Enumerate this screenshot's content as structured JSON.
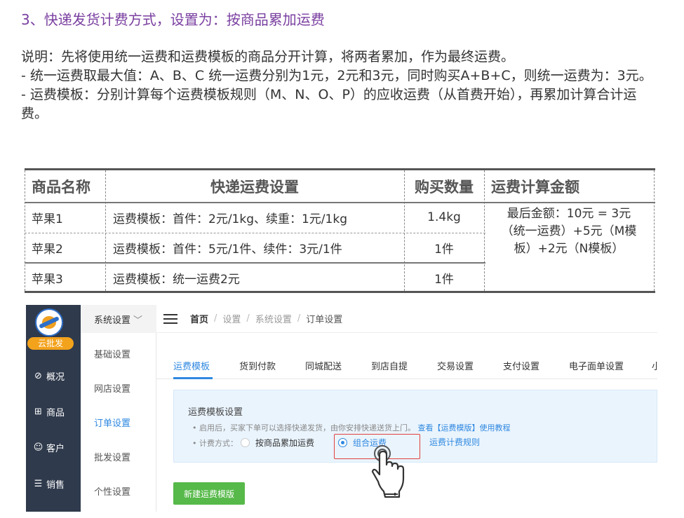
{
  "heading": "3、快递发货计费方式，设置为：按商品累加运费",
  "description": {
    "line1": "说明：先将使用统一运费和运费模板的商品分开计算，将两者累加，作为最终运费。",
    "line2": "- 统一运费取最大值：A、B、C 统一运费分别为1元，2元和3元，同时购买A+B+C，则统一运费为：3元。",
    "line3": "- 运费模板：分别计算每个运费模板规则（M、N、O、P）的应收运费（从首费开始），再累加计算合计运费。"
  },
  "table": {
    "headers": [
      "商品名称",
      "快递运费设置",
      "购买数量",
      "运费计算金额"
    ],
    "rows": [
      {
        "name": "苹果1",
        "setting": "运费模板：首件：2元/1kg、续重：1元/1kg",
        "qty": "1.4kg"
      },
      {
        "name": "苹果2",
        "setting": "运费模板：首件：5元/1件、续件：3元/1件",
        "qty": "1件"
      },
      {
        "name": "苹果3",
        "setting": "运费模板：统一运费2元",
        "qty": "1件"
      }
    ],
    "total_line1": "最后金额：10元 = 3元",
    "total_line2": "（统一运费）+5元（M模",
    "total_line3": "板）+2元（N模板）"
  },
  "app": {
    "brand": "云批发",
    "main_nav": [
      {
        "label": "概况",
        "icon": "compass-icon"
      },
      {
        "label": "商品",
        "icon": "grid-icon"
      },
      {
        "label": "客户",
        "icon": "user-icon"
      },
      {
        "label": "销售",
        "icon": "list-icon"
      }
    ],
    "sub_nav_title": "系统设置",
    "sub_nav": [
      "基础设置",
      "网店设置",
      "订单设置",
      "批发设置",
      "个性设置"
    ],
    "sub_nav_active": "订单设置",
    "breadcrumb": [
      "首页",
      "设置",
      "系统设置",
      "订单设置"
    ],
    "tabs": [
      "运费模板",
      "货到付款",
      "同城配送",
      "到店自提",
      "交易设置",
      "支付设置",
      "电子面单设置",
      "小"
    ],
    "panel": {
      "title": "运费模板设置",
      "info_text": "• 启用后，买家下单可以选择快递发货，由你安排快递送货上门。",
      "info_link": "查看【运费模版】使用教程",
      "calc_label": "• 计费方式：",
      "option1": "按商品累加运费",
      "option2": "组合运费",
      "rule_link": "运费计费规则"
    },
    "new_button": "新建运费模版",
    "colors": {
      "sidebar": "#2f3a4c",
      "accent": "#2f88e0",
      "button": "#56b949",
      "badge": "#f3a21c"
    }
  }
}
